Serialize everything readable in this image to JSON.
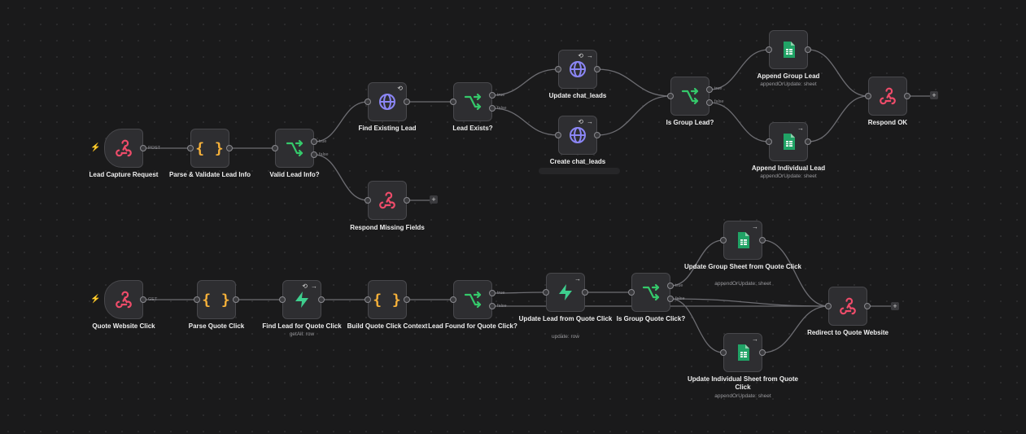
{
  "colors": {
    "canvas": "#1a1a1b",
    "node": "#2e2e31",
    "webhook": "#ef4c6a",
    "code": "#f6b13a",
    "if": "#35c96b",
    "http": "#8b86f5",
    "sheets": "#21a366",
    "supabase": "#3ecf8e",
    "trigger_bolt": "#ff6d3b"
  },
  "workflow": {
    "flow1": {
      "lead_capture": {
        "title": "Lead Capture Request",
        "icon": "webhook-icon",
        "method": "POST"
      },
      "parse_validate": {
        "title": "Parse & Validate Lead Info",
        "icon": "code-braces-icon"
      },
      "valid_lead": {
        "title": "Valid Lead Info?",
        "icon": "if-branch-icon",
        "out_true": "true",
        "out_false": "false"
      },
      "find_existing": {
        "title": "Find Existing Lead",
        "icon": "globe-icon"
      },
      "respond_missing": {
        "title": "Respond Missing Fields",
        "icon": "webhook-icon"
      },
      "lead_exists": {
        "title": "Lead Exists?",
        "icon": "if-branch-icon",
        "out_true": "true",
        "out_false": "false"
      },
      "update_chat": {
        "title": "Update chat_leads",
        "icon": "globe-icon"
      },
      "create_chat": {
        "title": "Create chat_leads",
        "icon": "globe-icon"
      },
      "is_group": {
        "title": "Is Group Lead?",
        "icon": "if-branch-icon",
        "out_true": "true",
        "out_false": "false"
      },
      "append_group": {
        "title": "Append Group Lead",
        "subtitle": "appendOrUpdate: sheet",
        "icon": "sheets-icon"
      },
      "append_individual": {
        "title": "Append Individual Lead",
        "subtitle": "appendOrUpdate: sheet",
        "icon": "sheets-icon"
      },
      "respond_ok": {
        "title": "Respond OK",
        "icon": "webhook-icon"
      }
    },
    "flow2": {
      "quote_click": {
        "title": "Quote Website Click",
        "icon": "webhook-icon",
        "method": "GET"
      },
      "parse_quote": {
        "title": "Parse Quote Click",
        "icon": "code-braces-icon"
      },
      "find_lead_quote": {
        "title": "Find Lead for Quote Click",
        "subtitle": "getAll: row",
        "icon": "supabase-icon"
      },
      "build_context": {
        "title": "Build Quote Click Context",
        "icon": "code-braces-icon"
      },
      "lead_found": {
        "title": "Lead Found for Quote Click?",
        "icon": "if-branch-icon",
        "out_true": "true",
        "out_false": "false"
      },
      "update_lead_quote": {
        "title": "Update Lead from Quote Click",
        "subtitle": "update: row",
        "icon": "supabase-icon"
      },
      "is_group_quote": {
        "title": "Is Group Quote Click?",
        "icon": "if-branch-icon",
        "out_true": "true",
        "out_false": "false"
      },
      "update_group_sheet": {
        "title": "Update Group Sheet from Quote Click",
        "subtitle": "appendOrUpdate: sheet",
        "icon": "sheets-icon"
      },
      "update_individual_sheet": {
        "title": "Update Individual Sheet from Quote Click",
        "subtitle": "appendOrUpdate: sheet",
        "icon": "sheets-icon"
      },
      "redirect": {
        "title": "Redirect to Quote Website",
        "icon": "webhook-icon"
      }
    }
  },
  "glyphs": {
    "add": "+",
    "bolt": "⚡",
    "arrow": "→",
    "loop": "⟲"
  }
}
